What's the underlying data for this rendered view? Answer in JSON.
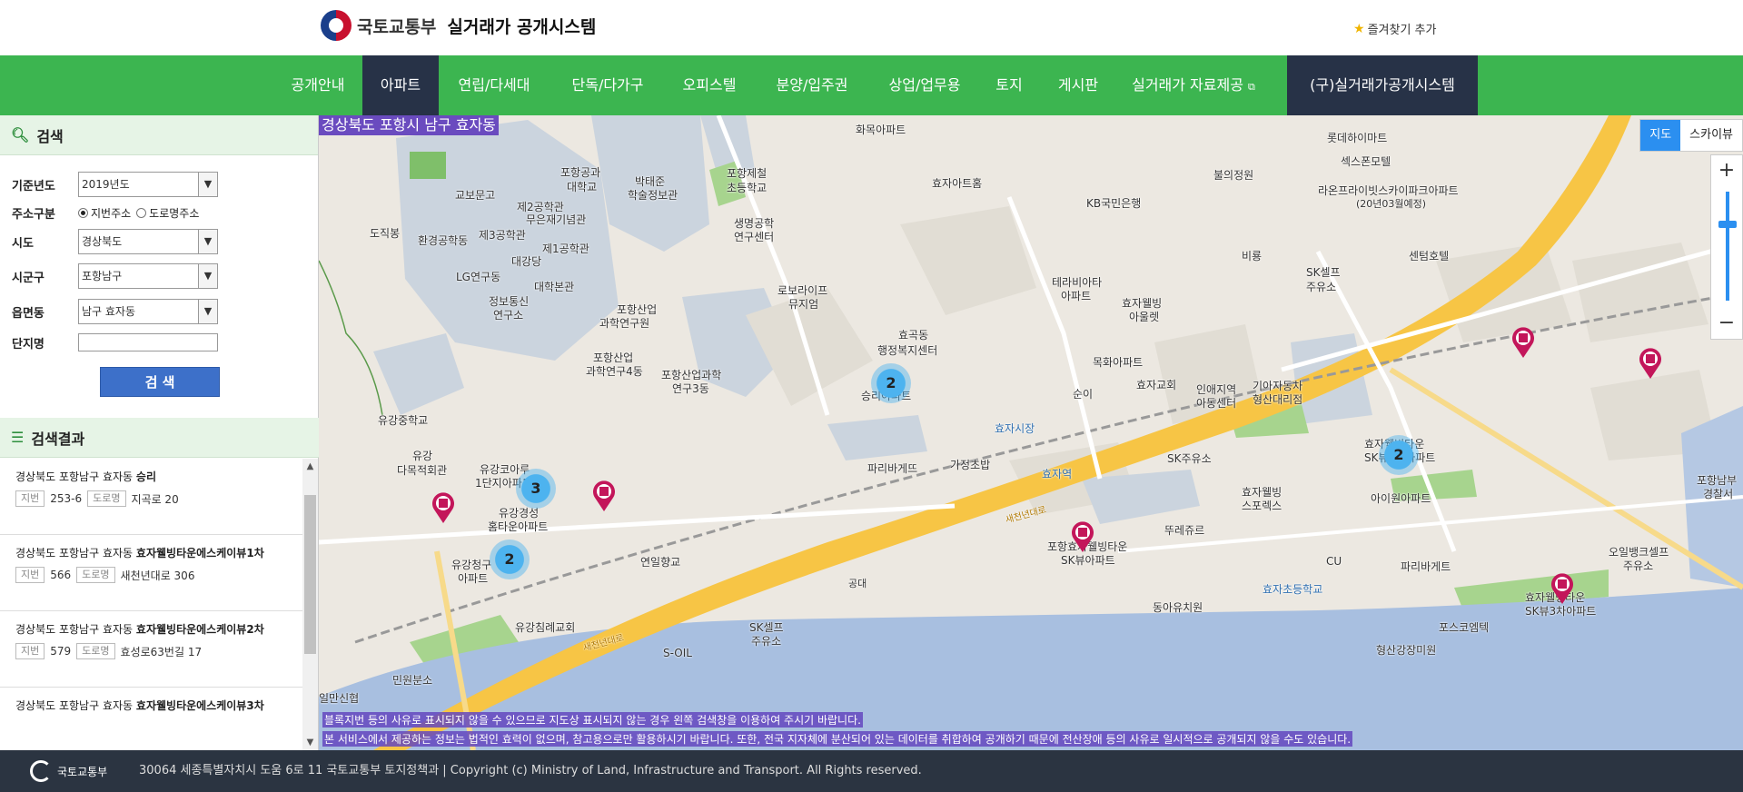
{
  "header": {
    "org": "국토교통부",
    "title": "실거래가 공개시스템",
    "favorite": "즐겨찾기 추가"
  },
  "nav": {
    "items": [
      "공개안내",
      "아파트",
      "연립/다세대",
      "단독/다가구",
      "오피스텔",
      "분양/입주권",
      "상업/업무용",
      "토지",
      "게시판",
      "실거래가 자료제공",
      "(구)실거래가공개시스템"
    ],
    "active": "아파트"
  },
  "search": {
    "title": "검색",
    "year_label": "기준년도",
    "year_value": "2019년도",
    "addr_type_label": "주소구분",
    "addr_type_jibun": "지번주소",
    "addr_type_road": "도로명주소",
    "sido_label": "시도",
    "sido_value": "경상북도",
    "sigungu_label": "시군구",
    "sigungu_value": "포항남구",
    "emd_label": "읍면동",
    "emd_value": "남구 효자동",
    "complex_label": "단지명",
    "complex_value": "",
    "button": "검 색"
  },
  "results": {
    "title": "검색결과",
    "jibun_tag": "지번",
    "road_tag": "도로명",
    "items": [
      {
        "prefix": "경상북도 포항남구 효자동",
        "name": "승리",
        "jibun": "253-6",
        "road": "지곡로 20"
      },
      {
        "prefix": "경상북도 포항남구 효자동",
        "name": "효자웰빙타운에스케이뷰1차",
        "jibun": "566",
        "road": "새천년대로 306"
      },
      {
        "prefix": "경상북도 포항남구 효자동",
        "name": "효자웰빙타운에스케이뷰2차",
        "jibun": "579",
        "road": "효성로63번길 17"
      },
      {
        "prefix": "경상북도 포항남구 효자동",
        "name": "효자웰빙타운에스케이뷰3차",
        "jibun": "",
        "road": ""
      }
    ]
  },
  "map": {
    "region": "경상북도 포항시 남구 효자동",
    "type_map": "지도",
    "type_sky": "스카이뷰",
    "zoom_in": "+",
    "zoom_out": "−",
    "clusters": [
      "2",
      "3",
      "2",
      "2"
    ],
    "labels": {
      "l1": "화목아파트",
      "l2": "효자아트홈",
      "l3": "KB국민은행",
      "l4": "롯데하이마트",
      "l5": "불의정원",
      "l6": "섹스폰모텔",
      "l7": "라온프라이빗스카이파크아파트",
      "l8": "(20년03월예정)",
      "l9": "센텀호텔",
      "l10": "SK셀프",
      "l11": "주유소",
      "l12": "포항공과",
      "l13": "대학교",
      "l14": "박태준",
      "l15": "학술정보관",
      "l16": "포항제철",
      "l17": "초등학교",
      "l18": "교보문고",
      "l19": "제2공학관",
      "l20": "제3공학관",
      "l21": "무은재기념관",
      "l22": "제1공학관",
      "l23": "대강당",
      "l24": "LG연구동",
      "l25": "정보통신",
      "l26": "연구소",
      "l27": "대학본관",
      "l28": "포항산업",
      "l29": "과학연구원",
      "l30": "생명공학",
      "l31": "연구센터",
      "l32": "로보라이프",
      "l33": "뮤지엄",
      "l34": "환경공학동",
      "l35": "도직봉",
      "l36": "효곡동",
      "l37": "행정복지센터",
      "l38": "승리아파트",
      "l39": "테라비아타",
      "l40": "아파트",
      "l41": "효자웰빙",
      "l42": "아울렛",
      "l43": "목화아파트",
      "l44": "효자교회",
      "l45": "순이",
      "l46": "인애지역",
      "l47": "아동센터",
      "l48": "기아자동차",
      "l49": "형산대리점",
      "l50": "효자시장",
      "l51": "파리바게뜨",
      "l52": "가정초밥",
      "l53": "효자역",
      "l54": "SK주유소",
      "l55": "효자웰빙타운",
      "l56": "SK뷰2차아파트",
      "l57": "효자웰빙",
      "l58": "스포렉스",
      "l59": "뚜레쥬르",
      "l60": "포항효자웰빙타운",
      "l61": "SK뷰아파트",
      "l62": "CU",
      "l63": "파리바게트",
      "l64": "동아유치원",
      "l65": "효자초등학교",
      "l66": "포스코엠텍",
      "l67": "형산강장미원",
      "l68": "오일뱅크셀프",
      "l69": "주유소",
      "l70": "효자웰빙타운",
      "l71": "SK뷰3차아파트",
      "l72": "포항남부",
      "l73": "경찰서",
      "l74": "유강중학교",
      "l75": "유강",
      "l76": "다목적회관",
      "l77": "유강코아루",
      "l78": "1단지아파트",
      "l79": "유강경성",
      "l80": "홈타운아파트",
      "l81": "유강청구",
      "l82": "아파트",
      "l83": "연일향교",
      "l84": "유강침례교회",
      "l85": "SK셀프",
      "l86": "주유소",
      "l87": "S-OIL",
      "l88": "민원분소",
      "l89": "일만신협",
      "l90": "포항산업과학",
      "l91": "연구3동",
      "l92": "포항산업",
      "l93": "과학연구4동",
      "l94": "비룡",
      "l95": "아이원아파트",
      "l96": "새천년대로",
      "l97": "공대",
      "l98": "새천년대로"
    },
    "notice1": "블록지번 등의 사유로 표시되지 않을 수 있으므로 지도상 표시되지 않는 경우 왼쪽 검색창을 이용하여 주시기 바랍니다.",
    "notice2": "본 서비스에서 제공하는 정보는 법적인 효력이 없으며, 참고용으로만 활용하시기 바랍니다. 또한, 전국 지자체에 분산되어 있는 데이터를 취합하여 공개하기 때문에 전산장애 등의 사유로 일시적으로 공개되지 않을 수도 있습니다."
  },
  "footer": {
    "org": "국토교통부",
    "text": "30064 세종특별자치시 도움 6로 11 국토교통부 토지정책과  |  Copyright (c) Ministry of Land, Infrastructure and Transport. All Rights reserved."
  },
  "colors": {
    "green": "#3cb550",
    "navy": "#273247",
    "blue": "#3d70c9",
    "footer": "#2b3441"
  }
}
